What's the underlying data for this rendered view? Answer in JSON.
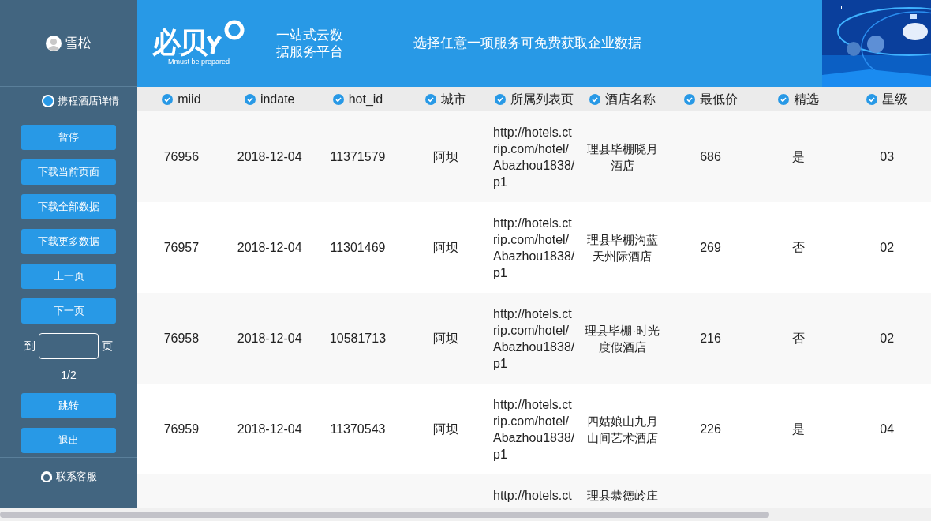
{
  "user": {
    "name": "雪松"
  },
  "header": {
    "logo": "必贝",
    "tagline": "Mmust be prepared",
    "slogan": "一站式云数据服务平台",
    "banner": "选择任意一项服务可免费获取企业数据"
  },
  "sidebar": {
    "source": {
      "label": "携程酒店详情",
      "selected": true
    },
    "buttons": [
      "暂停",
      "下载当前页面",
      "下载全部数据",
      "下载更多数据",
      "上一页",
      "下一页"
    ],
    "page_jump": {
      "prefix": "到",
      "suffix": "页",
      "page_info": "1/2"
    },
    "buttons_after": [
      "跳转",
      "退出"
    ],
    "contact": "联系客服"
  },
  "table": {
    "columns": [
      {
        "label": "miid",
        "checked": true
      },
      {
        "label": "indate",
        "checked": true
      },
      {
        "label": "hot_id",
        "checked": true
      },
      {
        "label": "城市",
        "checked": true
      },
      {
        "label": "所属列表页",
        "checked": true
      },
      {
        "label": "酒店名称",
        "checked": true
      },
      {
        "label": "最低价",
        "checked": true
      },
      {
        "label": "精选",
        "checked": true
      },
      {
        "label": "星级",
        "checked": true
      }
    ],
    "rows": [
      [
        "76956",
        "2018-12-04",
        "11371579",
        "阿坝",
        "http://hotels.ctrip.com/hotel/Abazhou1838/p1",
        "理县毕棚晓月酒店",
        "686",
        "是",
        "03"
      ],
      [
        "76957",
        "2018-12-04",
        "11301469",
        "阿坝",
        "http://hotels.ctrip.com/hotel/Abazhou1838/p1",
        "理县毕棚沟蓝天州际酒店",
        "269",
        "否",
        "02"
      ],
      [
        "76958",
        "2018-12-04",
        "10581713",
        "阿坝",
        "http://hotels.ctrip.com/hotel/Abazhou1838/p1",
        "理县毕棚·时光度假酒店",
        "216",
        "否",
        "02"
      ],
      [
        "76959",
        "2018-12-04",
        "11370543",
        "阿坝",
        "http://hotels.ctrip.com/hotel/Abazhou1838/p1",
        "四姑娘山九月山间艺术酒店",
        "226",
        "是",
        "04"
      ],
      [
        "",
        "",
        "",
        "",
        "http://hotels.ct",
        "理县恭德岭庄",
        "",
        "",
        ""
      ]
    ]
  }
}
